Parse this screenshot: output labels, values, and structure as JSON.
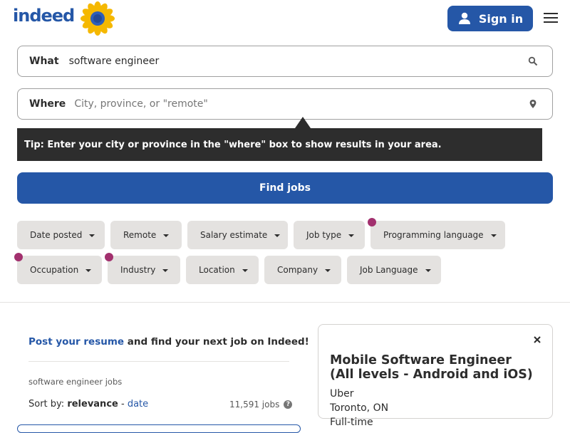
{
  "header": {
    "logo_text": "indeed",
    "sign_in_label": "Sign in",
    "brand_color": "#2557a7"
  },
  "search": {
    "what_label": "What",
    "what_value": "software engineer",
    "where_label": "Where",
    "where_placeholder": "City, province, or \"remote\""
  },
  "tip": {
    "text": "Tip: Enter your city or province in the \"where\" box to show results in your area."
  },
  "find_jobs_label": "Find jobs",
  "filters": [
    {
      "label": "Date posted",
      "dot": false
    },
    {
      "label": "Remote",
      "dot": false
    },
    {
      "label": "Salary estimate",
      "dot": false
    },
    {
      "label": "Job type",
      "dot": false
    },
    {
      "label": "Programming language",
      "dot": true
    },
    {
      "label": "Occupation",
      "dot": true
    },
    {
      "label": "Industry",
      "dot": true
    },
    {
      "label": "Location",
      "dot": false
    },
    {
      "label": "Company",
      "dot": false
    },
    {
      "label": "Job Language",
      "dot": false
    }
  ],
  "results": {
    "post_resume_link": "Post your resume",
    "post_resume_rest": " and find your next job on Indeed!",
    "category": "software engineer jobs",
    "sort_by_label": "Sort by:",
    "sort_relevance": "relevance",
    "sort_separator": " - ",
    "sort_date": "date",
    "job_count": "11,591 jobs",
    "help_glyph": "?"
  },
  "job_detail": {
    "title": "Mobile Software Engineer (All levels - Android and iOS)",
    "company": "Uber",
    "location": "Toronto, ON",
    "job_type": "Full-time"
  },
  "icons": {
    "user": "user-icon",
    "menu": "hamburger-menu-icon",
    "search": "search-icon",
    "location": "location-pin-icon",
    "close": "close-icon",
    "caret": "caret-down-icon",
    "sunflower": "sunflower-icon"
  },
  "colors": {
    "accent": "#2557a7",
    "tooltip_bg": "#2d2d2d",
    "chip_bg": "#e4e2e0",
    "filter_dot": "#a2306e"
  }
}
